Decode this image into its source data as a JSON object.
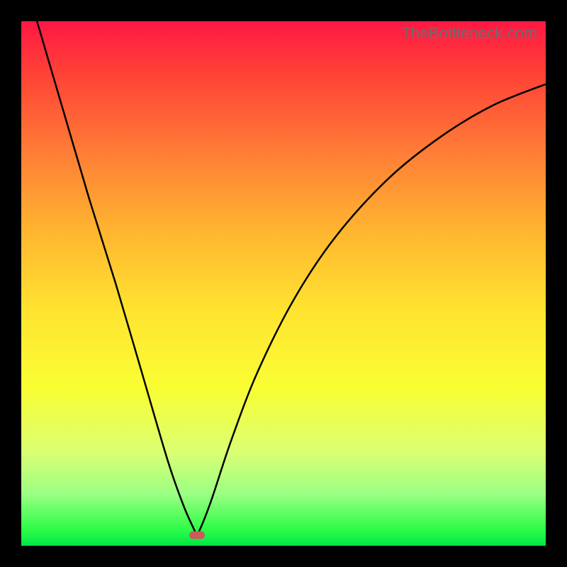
{
  "watermark": "TheBottleneck.com",
  "marker_color": "#cc5b5b",
  "curve_color": "#000000",
  "gradient_stops": [
    "#ff1744",
    "#ff4236",
    "#ff7d36",
    "#ffb530",
    "#ffe330",
    "#f9fe33",
    "#dbff72",
    "#9cff84",
    "#2cfc48",
    "#00e547"
  ],
  "chart_data": {
    "type": "line",
    "title": "",
    "xlabel": "",
    "ylabel": "",
    "xlim": [
      0,
      1
    ],
    "ylim": [
      0,
      1
    ],
    "notch_x": 0.335,
    "notch_y": 0.02,
    "series": [
      {
        "name": "left-branch",
        "x": [
          0.03,
          0.08,
          0.13,
          0.18,
          0.23,
          0.28,
          0.31,
          0.33,
          0.335
        ],
        "y": [
          1.0,
          0.83,
          0.66,
          0.5,
          0.33,
          0.16,
          0.075,
          0.03,
          0.02
        ]
      },
      {
        "name": "right-branch",
        "x": [
          0.335,
          0.36,
          0.4,
          0.45,
          0.52,
          0.6,
          0.7,
          0.8,
          0.9,
          1.0
        ],
        "y": [
          0.02,
          0.08,
          0.2,
          0.33,
          0.47,
          0.59,
          0.7,
          0.78,
          0.84,
          0.88
        ]
      }
    ],
    "marker": {
      "x": 0.335,
      "y": 0.02
    }
  }
}
